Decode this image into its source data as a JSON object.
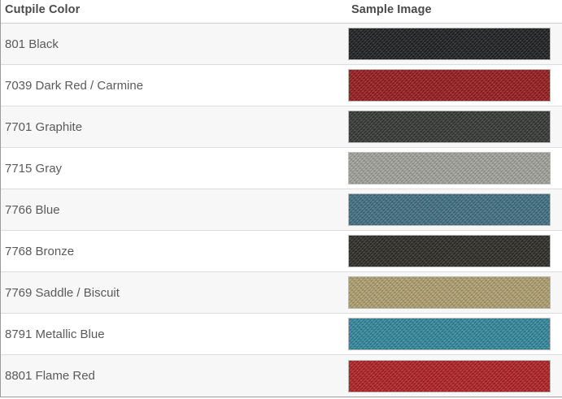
{
  "table": {
    "headers": {
      "color": "Cutpile Color",
      "image": "Sample Image"
    },
    "rows": [
      {
        "name": "801 Black",
        "swatch": "#1c1d1e"
      },
      {
        "name": "7039 Dark Red / Carmine",
        "swatch": "#97191c"
      },
      {
        "name": "7701 Graphite",
        "swatch": "#343634"
      },
      {
        "name": "7715 Gray",
        "swatch": "#a3a39d"
      },
      {
        "name": "7766 Blue",
        "swatch": "#3f6f82"
      },
      {
        "name": "7768 Bronze",
        "swatch": "#2b2a25"
      },
      {
        "name": "7769 Saddle / Biscuit",
        "swatch": "#b0a070"
      },
      {
        "name": "8791 Metallic Blue",
        "swatch": "#2f889c"
      },
      {
        "name": "8801 Flame Red",
        "swatch": "#b11e22"
      }
    ]
  }
}
